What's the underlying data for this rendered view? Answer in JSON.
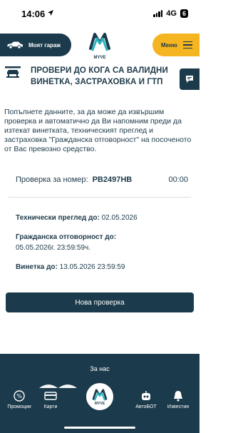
{
  "status_bar": {
    "time": "14:06",
    "network": "4G",
    "battery": "6"
  },
  "top_nav": {
    "garage_label": "Моят гараж",
    "logo_text": "MYVE",
    "menu_label": "Меню"
  },
  "page": {
    "title_line1": "ПРОВЕРИ ДО КОГА СА ВАЛИДНИ",
    "title_line2": "ВИНЕТКА, ЗАСТРАХОВКА И ГТП",
    "intro": "Попълнете данните, за да може да извършим проверка и автоматично да Ви напомним преди да изтекат винетката, техническият преглед и застраховка \"Гражданска отговорност\" на посоченото от Вас превозно средство."
  },
  "check": {
    "label": "Проверка за номер:",
    "plate": "PB2497HB",
    "timer": "00:00"
  },
  "results": [
    {
      "label": "Технически преглед до:",
      "value": "02.05.2026"
    },
    {
      "label": "Гражданска отговорност до:",
      "value": "05.05.2026г. 23:59:59ч."
    },
    {
      "label": "Винетка до:",
      "value": "13.05.2026 23:59:59"
    }
  ],
  "new_check_label": "Нова проверка",
  "footer": {
    "about_label": "За нас"
  },
  "bottom_nav": [
    {
      "label": "Промоции",
      "icon": "promo-icon"
    },
    {
      "label": "Карти",
      "icon": "card-icon"
    },
    {
      "label": "MYVE",
      "icon": "myve-logo-icon"
    },
    {
      "label": "АвтоБОТ",
      "icon": "robot-icon"
    },
    {
      "label": "Известия",
      "icon": "bell-icon"
    }
  ],
  "colors": {
    "primary": "#1b3a4b",
    "accent": "#f4b521",
    "brand_teal": "#2bb3c0"
  }
}
